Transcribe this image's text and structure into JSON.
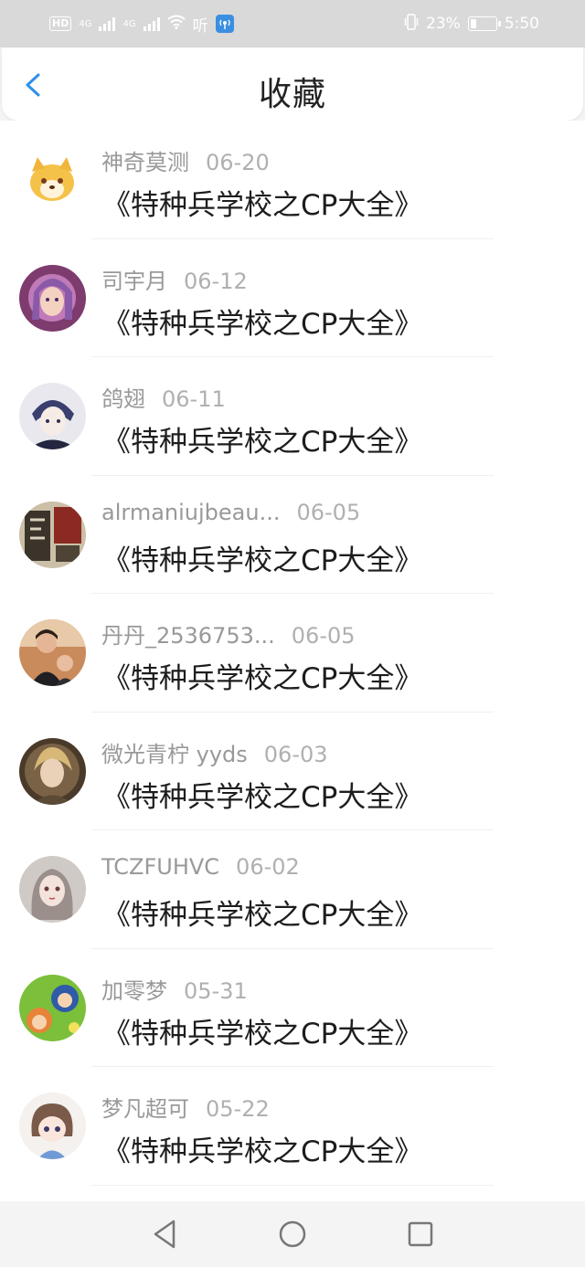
{
  "status_bar": {
    "hd": "HD",
    "net1": "4G",
    "net2": "4G",
    "hear": "听",
    "battery_percent": "23%",
    "battery_level": 0.23,
    "time": "5:50"
  },
  "header": {
    "title": "收藏"
  },
  "items": [
    {
      "user": "神奇莫测",
      "date": "06-20",
      "title": "《特种兵学校之CP大全》",
      "avatar": "shiba-avatar"
    },
    {
      "user": "司宇月",
      "date": "06-12",
      "title": "《特种兵学校之CP大全》",
      "avatar": "princess-avatar"
    },
    {
      "user": "鸽翅",
      "date": "06-11",
      "title": "《特种兵学校之CP大全》",
      "avatar": "anime-boy-avatar"
    },
    {
      "user": "alrmaniujbeau...",
      "date": "06-05",
      "title": "《特种兵学校之CP大全》",
      "avatar": "poster-avatar"
    },
    {
      "user": "丹丹_2536753...",
      "date": "06-05",
      "title": "《特种兵学校之CP大全》",
      "avatar": "photo-avatar"
    },
    {
      "user": "微光青柠 yyds",
      "date": "06-03",
      "title": "《特种兵学校之CP大全》",
      "avatar": "painting-avatar"
    },
    {
      "user": "TCZFUHVC",
      "date": "06-02",
      "title": "《特种兵学校之CP大全》",
      "avatar": "anime-girl-avatar"
    },
    {
      "user": "加零梦",
      "date": "05-31",
      "title": "《特种兵学校之CP大全》",
      "avatar": "cartoon-avatar"
    },
    {
      "user": "梦凡超可",
      "date": "05-22",
      "title": "《特种兵学校之CP大全》",
      "avatar": "chibi-avatar"
    }
  ],
  "colors": {
    "accent": "#2f8fe8",
    "status_bar": "#d9d9d9"
  }
}
